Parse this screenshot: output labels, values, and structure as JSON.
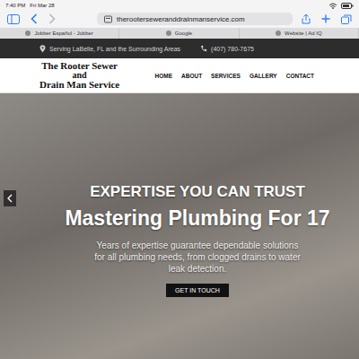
{
  "status_bar": {
    "time": "7:40 PM",
    "date": "Fri Mar 28"
  },
  "browser": {
    "url": "therooterseweranddrainmanservice.com",
    "tabs": [
      {
        "label": "Jobber Español - Jobber"
      },
      {
        "label": "Google"
      },
      {
        "label": "Website | Ad IQ"
      }
    ]
  },
  "site": {
    "top_bar": {
      "location": "Serving LaBelle, FL and the Surrounding Areas",
      "phone": "(407) 780-7675"
    },
    "logo": [
      "The Rooter Sewer",
      "and",
      "Drain Man Service"
    ],
    "nav": [
      "HOME",
      "ABOUT",
      "SERVICES",
      "GALLERY",
      "CONTACT"
    ],
    "hero": {
      "eyebrow": "EXPERTISE YOU CAN TRUST",
      "title": "Mastering Plumbing For 17",
      "text": "Years of expertise guarantee dependable solutions for all plumbing needs, from clogged drains to water leak detection.",
      "button": "GET IN TOUCH"
    }
  }
}
